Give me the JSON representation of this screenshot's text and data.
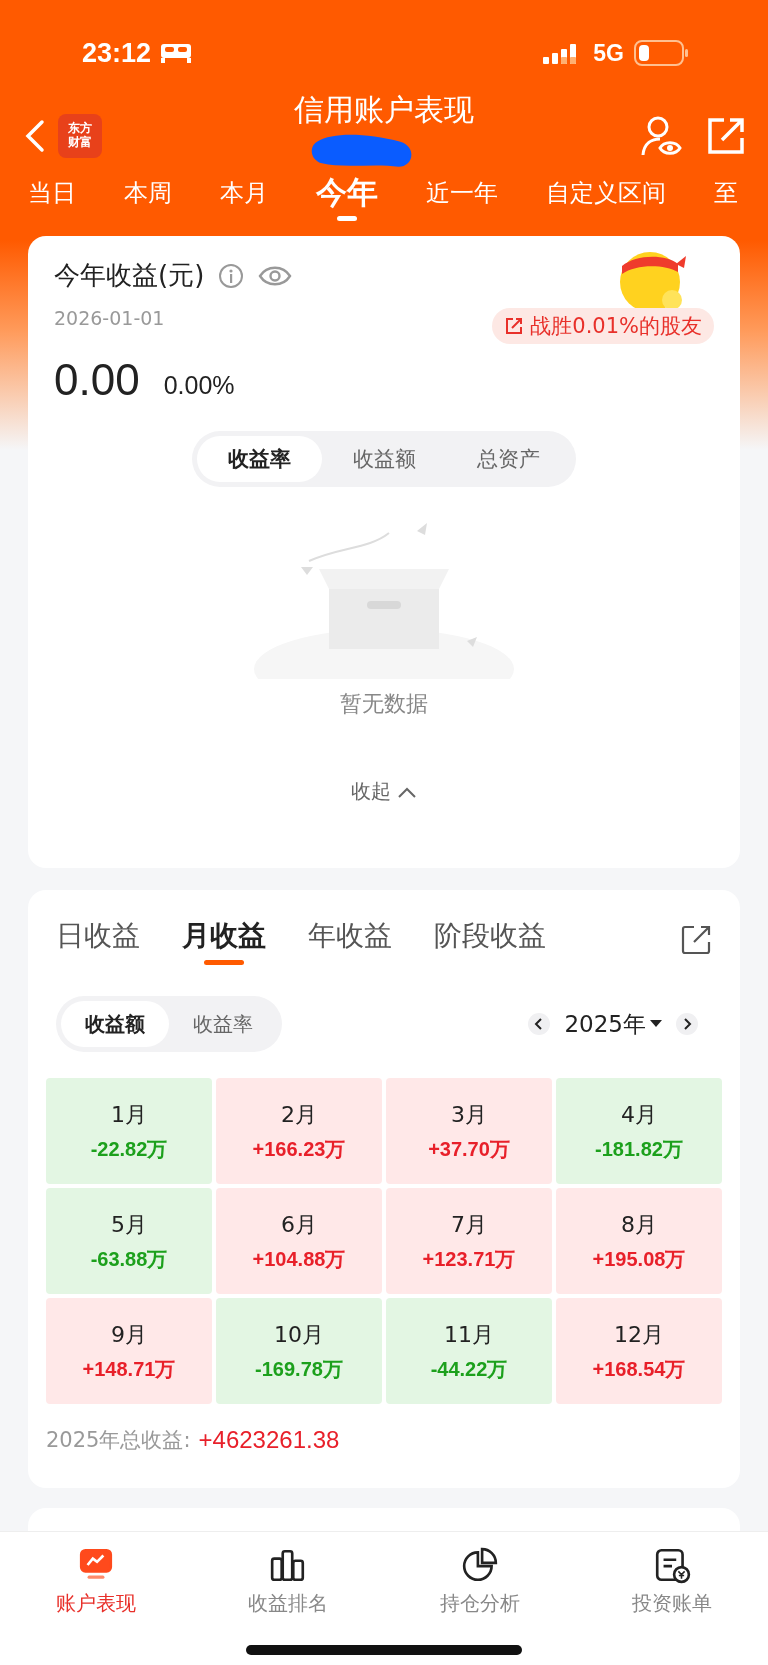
{
  "status_bar": {
    "time": "23:12",
    "network": "5G"
  },
  "header": {
    "title": "信用账户表现",
    "logo_text": [
      "东方",
      "财富"
    ]
  },
  "period_tabs": [
    {
      "label": "当日",
      "selected": false
    },
    {
      "label": "本周",
      "selected": false
    },
    {
      "label": "本月",
      "selected": false
    },
    {
      "label": "今年",
      "selected": true
    },
    {
      "label": "近一年",
      "selected": false
    },
    {
      "label": "自定义区间",
      "selected": false
    },
    {
      "label": "至",
      "selected": false
    }
  ],
  "summary": {
    "title": "今年收益(元)",
    "date": "2026-01-01",
    "badge": "战胜0.01%的股友",
    "amount": "0.00",
    "rate": "0.00%",
    "segments": [
      {
        "label": "收益率",
        "selected": true
      },
      {
        "label": "收益额",
        "selected": false
      },
      {
        "label": "总资产",
        "selected": false
      }
    ],
    "empty_text": "暂无数据",
    "collapse": "收起"
  },
  "monthly": {
    "tabs": [
      {
        "label": "日收益",
        "selected": false
      },
      {
        "label": "月收益",
        "selected": true
      },
      {
        "label": "年收益",
        "selected": false
      },
      {
        "label": "阶段收益",
        "selected": false
      }
    ],
    "segments": [
      {
        "label": "收益额",
        "selected": true
      },
      {
        "label": "收益率",
        "selected": false
      }
    ],
    "year": "2025年",
    "months": [
      {
        "month": "1月",
        "value": "-22.82万",
        "kind": "loss"
      },
      {
        "month": "2月",
        "value": "+166.23万",
        "kind": "gain"
      },
      {
        "month": "3月",
        "value": "+37.70万",
        "kind": "gain"
      },
      {
        "month": "4月",
        "value": "-181.82万",
        "kind": "loss"
      },
      {
        "month": "5月",
        "value": "-63.88万",
        "kind": "loss"
      },
      {
        "month": "6月",
        "value": "+104.88万",
        "kind": "gain"
      },
      {
        "month": "7月",
        "value": "+123.71万",
        "kind": "gain"
      },
      {
        "month": "8月",
        "value": "+195.08万",
        "kind": "gain"
      },
      {
        "month": "9月",
        "value": "+148.71万",
        "kind": "gain"
      },
      {
        "month": "10月",
        "value": "-169.78万",
        "kind": "loss"
      },
      {
        "month": "11月",
        "value": "-44.22万",
        "kind": "loss"
      },
      {
        "month": "12月",
        "value": "+168.54万",
        "kind": "gain"
      }
    ],
    "total_label": "2025年总收益:",
    "total_value": "+4623261.38"
  },
  "bottom_nav": [
    {
      "label": "账户表现",
      "selected": true
    },
    {
      "label": "收益排名",
      "selected": false
    },
    {
      "label": "持仓分析",
      "selected": false
    },
    {
      "label": "投资账单",
      "selected": false
    }
  ]
}
